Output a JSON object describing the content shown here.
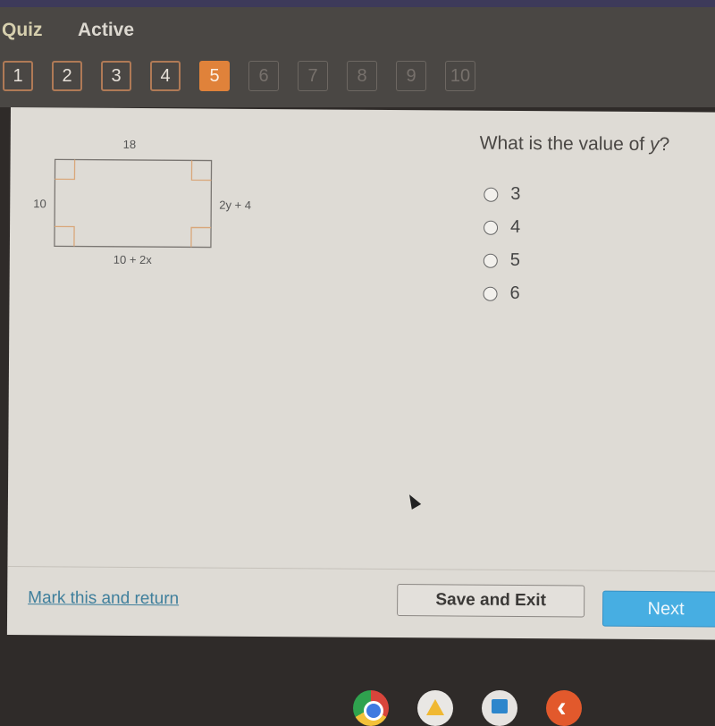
{
  "header": {
    "title": "Quiz",
    "status": "Active"
  },
  "question_numbers": [
    {
      "label": "1",
      "state": "answered"
    },
    {
      "label": "2",
      "state": "answered"
    },
    {
      "label": "3",
      "state": "answered"
    },
    {
      "label": "4",
      "state": "answered"
    },
    {
      "label": "5",
      "state": "current"
    },
    {
      "label": "6",
      "state": "locked"
    },
    {
      "label": "7",
      "state": "locked"
    },
    {
      "label": "8",
      "state": "locked"
    },
    {
      "label": "9",
      "state": "locked"
    },
    {
      "label": "10",
      "state": "locked"
    }
  ],
  "diagram": {
    "shape": "rectangle with four right-angle marks",
    "top_label": "18",
    "left_label": "10",
    "right_label": "2y + 4",
    "bottom_label": "10 + 2x"
  },
  "question": {
    "text_prefix": "What is the value of ",
    "variable": "y",
    "text_suffix": "?",
    "options": [
      "3",
      "4",
      "5",
      "6"
    ],
    "selected": null
  },
  "footer": {
    "mark_link": "Mark this and return",
    "save_button": "Save and Exit",
    "next_button": "Next"
  },
  "taskbar": {
    "apps": [
      "chrome-icon",
      "google-drive-icon",
      "files-icon",
      "app-icon"
    ]
  },
  "colors": {
    "current_question": "#e0823a",
    "next_button": "#47aee2",
    "link": "#3f7f9c",
    "right_angle_mark": "#d9a77a"
  }
}
